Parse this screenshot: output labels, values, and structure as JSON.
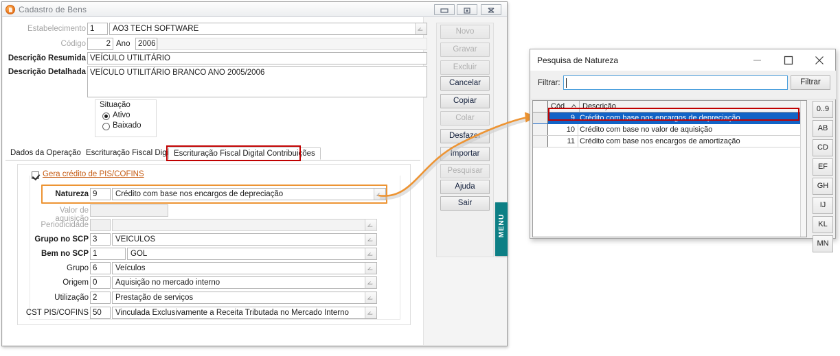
{
  "main_window": {
    "title": "Cadastro de Bens",
    "titlebar_buttons": [
      {
        "name": "minimize",
        "glyph": "minimize-icon"
      },
      {
        "name": "restore",
        "glyph": "restore-icon"
      },
      {
        "name": "close",
        "glyph": "close-icon"
      }
    ],
    "fields": {
      "estabelecimento_label": "Estabelecimento",
      "estabelecimento_code": "1",
      "estabelecimento_name": "AO3 TECH SOFTWARE",
      "codigo_label": "Código",
      "codigo_value": "2",
      "ano_label": "Ano",
      "ano_value": "2006",
      "desc_resumida_label": "Descrição Resumida",
      "desc_resumida_value": "VEÍCULO UTILITÁRIO",
      "desc_detalhada_label": "Descrição Detalhada",
      "desc_detalhada_value": "VEÍCULO UTILITÁRIO BRANCO ANO 2005/2006"
    },
    "situacao": {
      "title": "Situação",
      "options": [
        {
          "label": "Ativo",
          "selected": true
        },
        {
          "label": "Baixado",
          "selected": false
        }
      ]
    },
    "tabs": [
      {
        "label": "Dados da Operação",
        "active": false
      },
      {
        "label": "Escrituração Fiscal Digital",
        "active": false
      },
      {
        "label": "Escrituração Fiscal Digital Contribuições",
        "active": true,
        "highlighted": true
      }
    ],
    "panel": {
      "checkbox_label": "Gera crédito de PIS/COFINS",
      "checkbox_checked": true,
      "rows": [
        {
          "label": "Natureza",
          "code": "9",
          "value": "Crédito com base nos encargos de depreciação",
          "bold": true,
          "disabled": false,
          "combo": true,
          "highlighted": true
        },
        {
          "label": "Valor de aquisição",
          "code": "",
          "value": "",
          "bold": false,
          "disabled": true,
          "combo": false
        },
        {
          "label": "Periodicidade",
          "code": "",
          "value": "",
          "bold": false,
          "disabled": true,
          "combo": true
        },
        {
          "label": "Grupo no SCP",
          "code": "3",
          "value": "VEICULOS",
          "bold": true,
          "disabled": false,
          "combo": true
        },
        {
          "label": "Bem no SCP",
          "code": "1",
          "value": "GOL",
          "bold": true,
          "disabled": false,
          "combo": true
        },
        {
          "label": "Grupo",
          "code": "6",
          "value": "Veículos",
          "bold": false,
          "disabled": false,
          "combo": true
        },
        {
          "label": "Origem",
          "code": "0",
          "value": "Aquisição no mercado interno",
          "bold": false,
          "disabled": false,
          "combo": true
        },
        {
          "label": "Utilização",
          "code": "2",
          "value": "Prestação de serviços",
          "bold": false,
          "disabled": false,
          "combo": true
        },
        {
          "label": "CST PIS/COFINS",
          "code": "50",
          "value": "Vinculada Exclusivamente a Receita Tributada no Mercado Interno",
          "bold": false,
          "disabled": false,
          "combo": true
        }
      ]
    },
    "action_buttons": [
      {
        "label": "Novo",
        "accel": "N",
        "disabled": true
      },
      {
        "label": "Gravar",
        "accel": "G",
        "disabled": true
      },
      {
        "label": "Excluir",
        "accel": "E",
        "disabled": true
      },
      {
        "label": "Cancelar",
        "accel": "C",
        "disabled": false
      },
      {
        "label": "Copiar",
        "accel": "p",
        "disabled": false
      },
      {
        "label": "Colar",
        "accel": "l",
        "disabled": true
      },
      {
        "label": "Desfazer",
        "accel": "z",
        "disabled": false
      },
      {
        "label": "Importar",
        "accel": "I",
        "disabled": false
      },
      {
        "label": "Pesquisar",
        "accel": "P",
        "disabled": true
      },
      {
        "label": "Ajuda",
        "accel": "A",
        "disabled": false
      },
      {
        "label": "Sair",
        "accel": "S",
        "disabled": false
      }
    ],
    "menu_tab_label": "MENU"
  },
  "dialog": {
    "title": "Pesquisa de Natureza",
    "filter_label": "Filtrar:",
    "filter_value": "",
    "filter_button": "Filtrar",
    "columns": [
      "Cód",
      "Descrição"
    ],
    "sort_indicator": "ascending",
    "rows": [
      {
        "code": "9",
        "descricao": "Crédito com base nos encargos de depreciação",
        "selected": true,
        "highlighted": true
      },
      {
        "code": "10",
        "descricao": "Crédito com base no valor de aquisição",
        "selected": false
      },
      {
        "code": "11",
        "descricao": "Crédito com base nos encargos de amortização",
        "selected": false
      }
    ],
    "alpha_buttons": [
      "0..9",
      "AB",
      "CD",
      "EF",
      "GH",
      "IJ",
      "KL",
      "MN"
    ],
    "titlebar_buttons": [
      {
        "name": "minimize",
        "glyph": "minimize-icon"
      },
      {
        "name": "maximize",
        "glyph": "maximize-icon"
      },
      {
        "name": "close",
        "glyph": "close-icon"
      }
    ]
  },
  "annotation": {
    "arrow_color": "#ED9433",
    "highlight_red": "#C00000",
    "highlight_orange": "#ED9433",
    "link_color": "#C55A11",
    "selection_blue": "#1263C6",
    "menu_teal": "#0D7F85"
  }
}
